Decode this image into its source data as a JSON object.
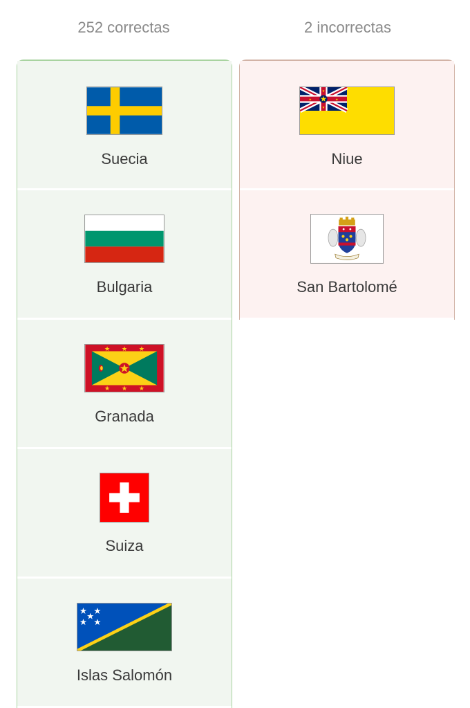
{
  "results": {
    "correct_label": "252 correctas",
    "incorrect_label": "2 incorrectas"
  },
  "correct_items": [
    {
      "name": "Suecia",
      "flag_icon": "sweden-flag-icon"
    },
    {
      "name": "Bulgaria",
      "flag_icon": "bulgaria-flag-icon"
    },
    {
      "name": "Granada",
      "flag_icon": "grenada-flag-icon"
    },
    {
      "name": "Suiza",
      "flag_icon": "switzerland-flag-icon"
    },
    {
      "name": "Islas Salomón",
      "flag_icon": "solomon-islands-flag-icon"
    }
  ],
  "incorrect_items": [
    {
      "name": "Niue",
      "flag_icon": "niue-flag-icon"
    },
    {
      "name": "San Bartolomé",
      "flag_icon": "saint-barthelemy-flag-icon"
    }
  ],
  "colors": {
    "correct_bg": "#f1f6f0",
    "correct_border": "#a8d3a0",
    "incorrect_bg": "#fdf2f1",
    "incorrect_border": "#d2b3a6"
  }
}
